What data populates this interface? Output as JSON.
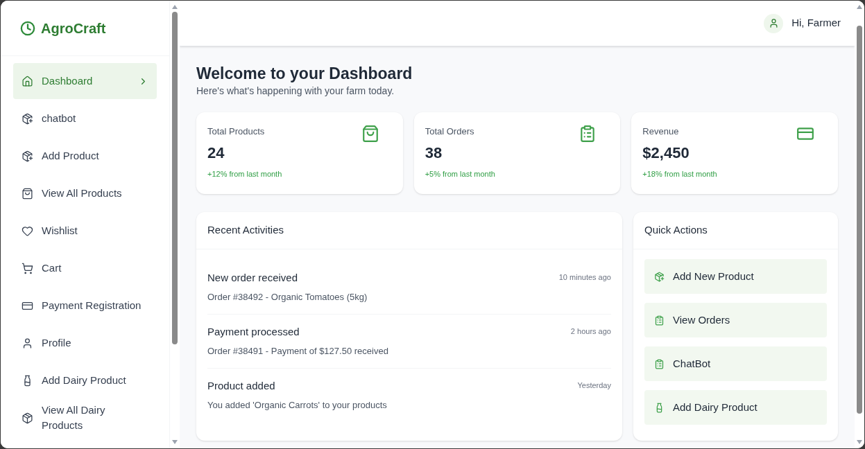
{
  "brand": "AgroCraft",
  "sidebar": {
    "items": [
      {
        "label": "Dashboard",
        "selected": true
      },
      {
        "label": "chatbot",
        "selected": false
      },
      {
        "label": "Add Product",
        "selected": false
      },
      {
        "label": "View All Products",
        "selected": false
      },
      {
        "label": "Wishlist",
        "selected": false
      },
      {
        "label": "Cart",
        "selected": false
      },
      {
        "label": "Payment Registration",
        "selected": false
      },
      {
        "label": "Profile",
        "selected": false
      },
      {
        "label": "Add Dairy Product",
        "selected": false
      },
      {
        "label": "View All Dairy Products",
        "selected": false
      }
    ]
  },
  "header": {
    "greeting": "Hi, Farmer"
  },
  "page": {
    "title": "Welcome to your Dashboard",
    "subtitle": "Here's what's happening with your farm today."
  },
  "stats": [
    {
      "label": "Total Products",
      "value": "24",
      "change": "+12% from last month"
    },
    {
      "label": "Total Orders",
      "value": "38",
      "change": "+5% from last month"
    },
    {
      "label": "Revenue",
      "value": "$2,450",
      "change": "+18% from last month"
    }
  ],
  "recent_activities": {
    "title": "Recent Activities",
    "items": [
      {
        "title": "New order received",
        "detail": "Order #38492 - Organic Tomatoes (5kg)",
        "time": "10 minutes ago"
      },
      {
        "title": "Payment processed",
        "detail": "Order #38491 - Payment of $127.50 received",
        "time": "2 hours ago"
      },
      {
        "title": "Product added",
        "detail": "You added 'Organic Carrots' to your products",
        "time": "Yesterday"
      }
    ]
  },
  "quick_actions": {
    "title": "Quick Actions",
    "items": [
      "Add New Product",
      "View Orders",
      "ChatBot",
      "Add Dairy Product"
    ]
  }
}
